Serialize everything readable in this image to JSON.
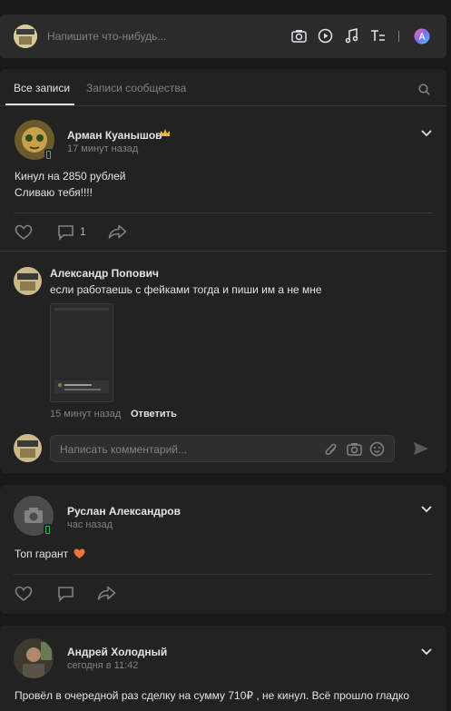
{
  "composer": {
    "placeholder": "Напишите что-нибудь...",
    "icons": [
      "camera-icon",
      "video-icon",
      "music-icon",
      "text-format-icon",
      "ai-icon"
    ]
  },
  "tabs": {
    "all_posts": "Все записи",
    "community_posts": "Записи сообщества"
  },
  "post1": {
    "author": "Арман Куанышов",
    "time": "17 минут назад",
    "text_line1": "Кинул на 2850 рублей",
    "text_line2": "Сливаю тебя!!!!",
    "comments_count": "1"
  },
  "comment1": {
    "author": "Александр Попович",
    "text": "если работаешь с фейками тогда и пиши им а не мне",
    "time": "15 минут назад",
    "reply_label": "Ответить"
  },
  "comment_input": {
    "placeholder": "Написать комментарий..."
  },
  "post2": {
    "author": "Руслан Александров",
    "time": "час назад",
    "text": "Топ гарант"
  },
  "post3": {
    "author": "Андрей Холодный",
    "time": "сегодня в 11:42",
    "text": "Провёл в очередной раз сделку на сумму 710₽ , не кинул. Всё прошло гладко"
  },
  "colors": {
    "background": "#19191a",
    "card": "#222222",
    "accent": "#e1e3e6",
    "muted": "#828282",
    "heart": "#e64646"
  }
}
